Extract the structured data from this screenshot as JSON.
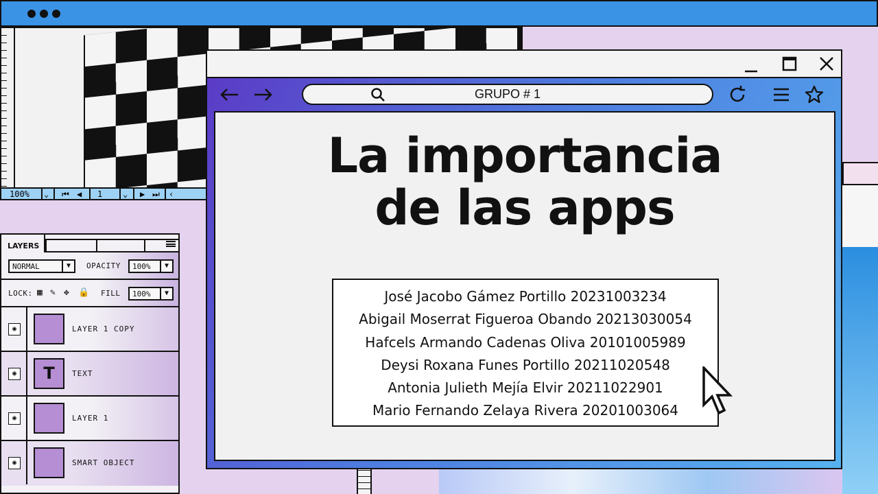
{
  "browser": {
    "url_text": "GRUPO # 1",
    "heading_line1": "La importancia",
    "heading_line2": "de las apps",
    "members": [
      "José Jacobo Gámez Portillo 20231003234",
      "Abigail Moserrat Figueroa Obando 20213030054",
      "Hafcels Armando Cadenas Oliva 20101005989",
      "Deysi Roxana Funes Portillo  20211020548",
      "Antonia Julieth Mejía Elvir 20211022901",
      "Mario Fernando Zelaya Rivera 20201003064"
    ]
  },
  "viewer": {
    "zoom": "100%",
    "page": "1"
  },
  "layers_panel": {
    "tab_label": "LAYERS",
    "blend_mode": "NORMAL",
    "opacity_label": "OPACITY",
    "opacity_value": "100%",
    "lock_label": "LOCK:",
    "fill_label": "FILL",
    "fill_value": "100%",
    "layers": [
      {
        "name": "LAYER 1 COPY",
        "thumb": ""
      },
      {
        "name": "TEXT",
        "thumb": "T"
      },
      {
        "name": "LAYER 1",
        "thumb": ""
      },
      {
        "name": "SMART OBJECT",
        "thumb": ""
      }
    ]
  },
  "colors": {
    "topbar": "#3b93e6",
    "thumb": "#b58ed3",
    "gradient_start": "#5b3bc6",
    "gradient_end": "#57b2f0"
  }
}
